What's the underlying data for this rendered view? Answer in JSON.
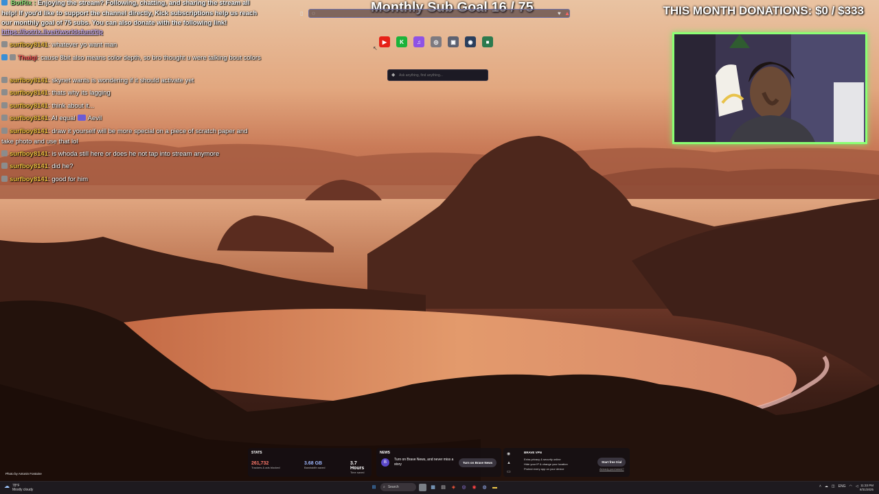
{
  "overlay": {
    "goal_title": "Monthly Sub Goal 16 / 75",
    "donations": "THIS MONTH DONATIONS: $0 / $333"
  },
  "chat": {
    "bot": {
      "name": "BotRix :",
      "message": "Enjoying the stream? Following, chatting, and sharing the stream all help! If you'd like to support the channel directly, Kick subscriptions help us reach our monthly goal of 75 subs. You can also donate with the following link!",
      "link": "https://botrix.live/t/worldsfunt/tip"
    },
    "messages": [
      {
        "user": "surfboy8141",
        "text": ": whatever yo want man"
      },
      {
        "user": "Thaiqi",
        "text": ": cause 8bit also means color depth, so bro thought u were talking bout colors"
      },
      {
        "user": "surfboy8141",
        "text": ": skynet wants is wondering if it should activate yet"
      },
      {
        "user": "surfboy8141",
        "text": ": thats why its lagging"
      },
      {
        "user": "surfboy8141",
        "text": ": think about it..."
      },
      {
        "user": "surfboy8141",
        "text": ": AI equal",
        "emote_text": "Aevil"
      },
      {
        "user": "surfboy8141",
        "text": ": draw it yourself will be more special on a piece of scratch paper and take photo and use that lol"
      },
      {
        "user": "surfboy8141",
        "text": ": is whoda still here or does he not tap into stream anymore"
      },
      {
        "user": "surfboy8141",
        "text": ": did he?"
      },
      {
        "user": "surfboy8141",
        "text": ": good for him"
      }
    ]
  },
  "browser": {
    "shortcuts": [
      {
        "name": "youtube-icon",
        "glyph": "▶",
        "color": "#e62117"
      },
      {
        "name": "kick-icon",
        "glyph": "K",
        "color": "#1bb33a"
      },
      {
        "name": "twitch-icon",
        "glyph": "♫",
        "color": "#8f52e5"
      },
      {
        "name": "chatgpt-icon",
        "glyph": "◎",
        "color": "#7d7a80"
      },
      {
        "name": "photo-site-icon",
        "glyph": "▣",
        "color": "#5d6170"
      },
      {
        "name": "steam-icon",
        "glyph": "◉",
        "color": "#2a3e5c"
      },
      {
        "name": "app-icon",
        "glyph": "■",
        "color": "#2c7a4e"
      }
    ],
    "search_placeholder": "Ask anything, find anything..."
  },
  "widgets": {
    "stats": {
      "heading": "STATS",
      "trackers_value": "261,732",
      "trackers_label": "Trackers & ads blocked",
      "bandwidth_value": "3.68 GB",
      "bandwidth_label": "Bandwidth saved",
      "time_value": "3.7 Hours",
      "time_label": "Time saved"
    },
    "news": {
      "heading": "NEWS",
      "body": "Turn on Brave News, and never miss a story",
      "button": "Turn on Brave News"
    },
    "vpn": {
      "heading": "BRAVE VPN",
      "items": [
        "Extra privacy & security online",
        "Hide your IP & change your location",
        "Protect every app on your device"
      ],
      "button": "Start free trial",
      "link": "Already purchased?"
    },
    "photo_credit": "Photo by Antonin Fontaine"
  },
  "taskbar": {
    "weather_temp": "78°F",
    "weather_desc": "Mostly cloudy",
    "search_label": "Search",
    "lang": "ENG",
    "time": "11:33 PM",
    "date": "8/31/2025"
  },
  "colors": {
    "webcam_border": "#8bff73",
    "chat_username": "#f0c141",
    "bot_name": "#8fe37a"
  }
}
